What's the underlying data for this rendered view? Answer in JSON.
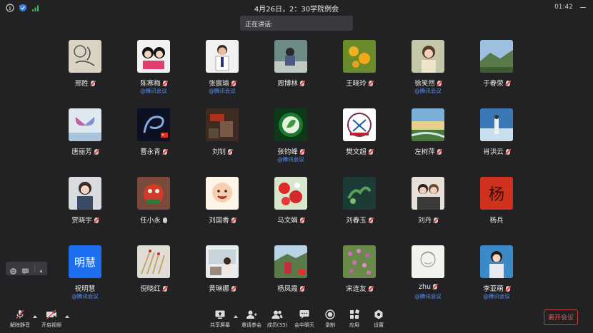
{
  "topbar": {
    "title": "4月26日，2：30学院例会",
    "clock": "01:42"
  },
  "speaking_label": "正在讲话:",
  "participants": [
    {
      "name": "邢胜",
      "mic": "muted",
      "sub": ""
    },
    {
      "name": "陈寒梅",
      "mic": "muted",
      "sub": "@腾讯会议"
    },
    {
      "name": "张宸瑜",
      "mic": "muted",
      "sub": "@腾讯会议"
    },
    {
      "name": "周博林",
      "mic": "muted",
      "sub": ""
    },
    {
      "name": "王晓玲",
      "mic": "muted",
      "sub": ""
    },
    {
      "name": "徐笑然",
      "mic": "muted",
      "sub": "@腾讯会议"
    },
    {
      "name": "于春荣",
      "mic": "muted",
      "sub": ""
    },
    {
      "name": "唐丽芳",
      "mic": "muted",
      "sub": ""
    },
    {
      "name": "曹永青",
      "mic": "muted",
      "sub": ""
    },
    {
      "name": "刘钊",
      "mic": "muted",
      "sub": ""
    },
    {
      "name": "张钧峰",
      "mic": "muted",
      "sub": "@腾讯会议"
    },
    {
      "name": "樊文超",
      "mic": "muted",
      "sub": ""
    },
    {
      "name": "左树萍",
      "mic": "muted",
      "sub": ""
    },
    {
      "name": "肖洪云",
      "mic": "muted",
      "sub": ""
    },
    {
      "name": "贾晓宇",
      "mic": "muted",
      "sub": ""
    },
    {
      "name": "任小永",
      "mic": "on",
      "sub": ""
    },
    {
      "name": "刘国香",
      "mic": "muted",
      "sub": ""
    },
    {
      "name": "马文娟",
      "mic": "muted",
      "sub": ""
    },
    {
      "name": "刘春玉",
      "mic": "muted",
      "sub": ""
    },
    {
      "name": "刘丹",
      "mic": "muted",
      "sub": ""
    },
    {
      "name": "杨兵",
      "mic": "none",
      "sub": ""
    },
    {
      "name": "祝明慧",
      "mic": "none",
      "sub": "@腾讯会议",
      "avatar_text": "明慧"
    },
    {
      "name": "倪晓红",
      "mic": "muted",
      "sub": ""
    },
    {
      "name": "黄琳娜",
      "mic": "muted",
      "sub": ""
    },
    {
      "name": "杨凤霞",
      "mic": "muted",
      "sub": ""
    },
    {
      "name": "宋连友",
      "mic": "muted",
      "sub": ""
    },
    {
      "name": "zhu",
      "mic": "muted",
      "sub": "@腾讯会议"
    },
    {
      "name": "李亚萌",
      "mic": "muted",
      "sub": "@腾讯会议"
    }
  ],
  "avatar_red_text": "杨",
  "toolbar": {
    "unmute": "解除静音",
    "video": "开启视频",
    "share": "共享屏幕",
    "invite": "邀请参会",
    "members": "成员(33)",
    "chat": "会中聊天",
    "record": "录制",
    "apps": "应用",
    "settings": "设置",
    "leave": "离开会议"
  },
  "colors": {
    "background": "#222225",
    "accent_blue": "#4f8ff7",
    "leave_red": "#e85a55"
  }
}
